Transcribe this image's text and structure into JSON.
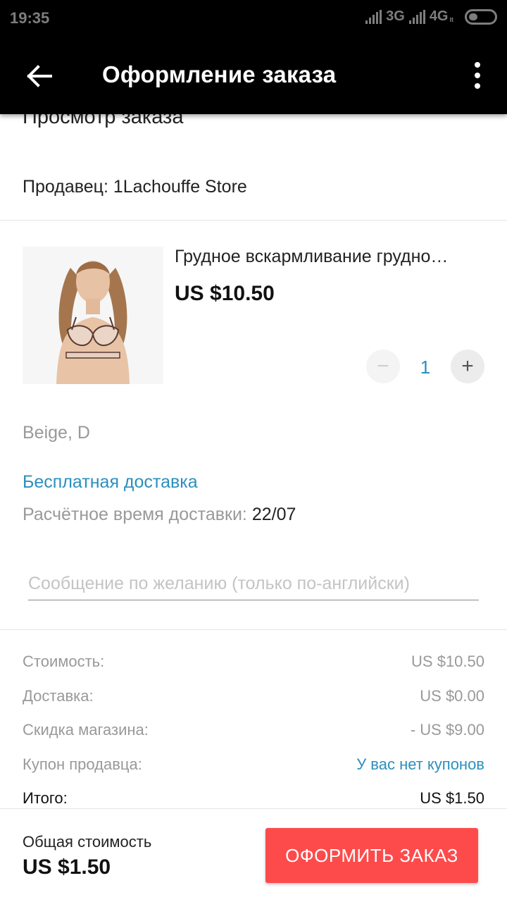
{
  "status_bar": {
    "time": "19:35",
    "network_1": "3G",
    "network_2": "4G",
    "network_2_sub": "lt"
  },
  "app_bar": {
    "back_icon": "arrow-left-icon",
    "title": "Оформление заказа",
    "menu_icon": "more-vert-icon"
  },
  "order": {
    "section_title": "Просмотр заказа",
    "seller": "Продавец: 1Lachouffe Store",
    "product": {
      "name": "Грудное вскармливание грудно…",
      "price": "US $10.50",
      "image": "product-photo",
      "quantity": "1",
      "minus_label": "−",
      "plus_label": "+",
      "variant": "Beige, D"
    },
    "shipping": {
      "free_label": "Бесплатная доставка",
      "eta_label": "Расчётное время доставки:",
      "eta_value": "22/07"
    },
    "message_placeholder": "Сообщение по желанию (только по-английски)"
  },
  "summary": [
    {
      "label": "Стоимость:",
      "value": "US $10.50"
    },
    {
      "label": "Доставка:",
      "value": "US $0.00"
    },
    {
      "label": "Скидка магазина:",
      "value": "- US $9.00"
    },
    {
      "label": "Купон продавца:",
      "value": "У вас нет купонов"
    },
    {
      "label": "Итого:",
      "value": "US $1.50"
    }
  ],
  "bottom": {
    "total_label": "Общая стоимость",
    "total_value": "US $1.50",
    "order_button": "ОФОРМИТЬ ЗАКАЗ"
  },
  "colors": {
    "accent_blue": "#2b8fbd",
    "button_red": "#fd4b4b",
    "app_bar": "#000000"
  }
}
